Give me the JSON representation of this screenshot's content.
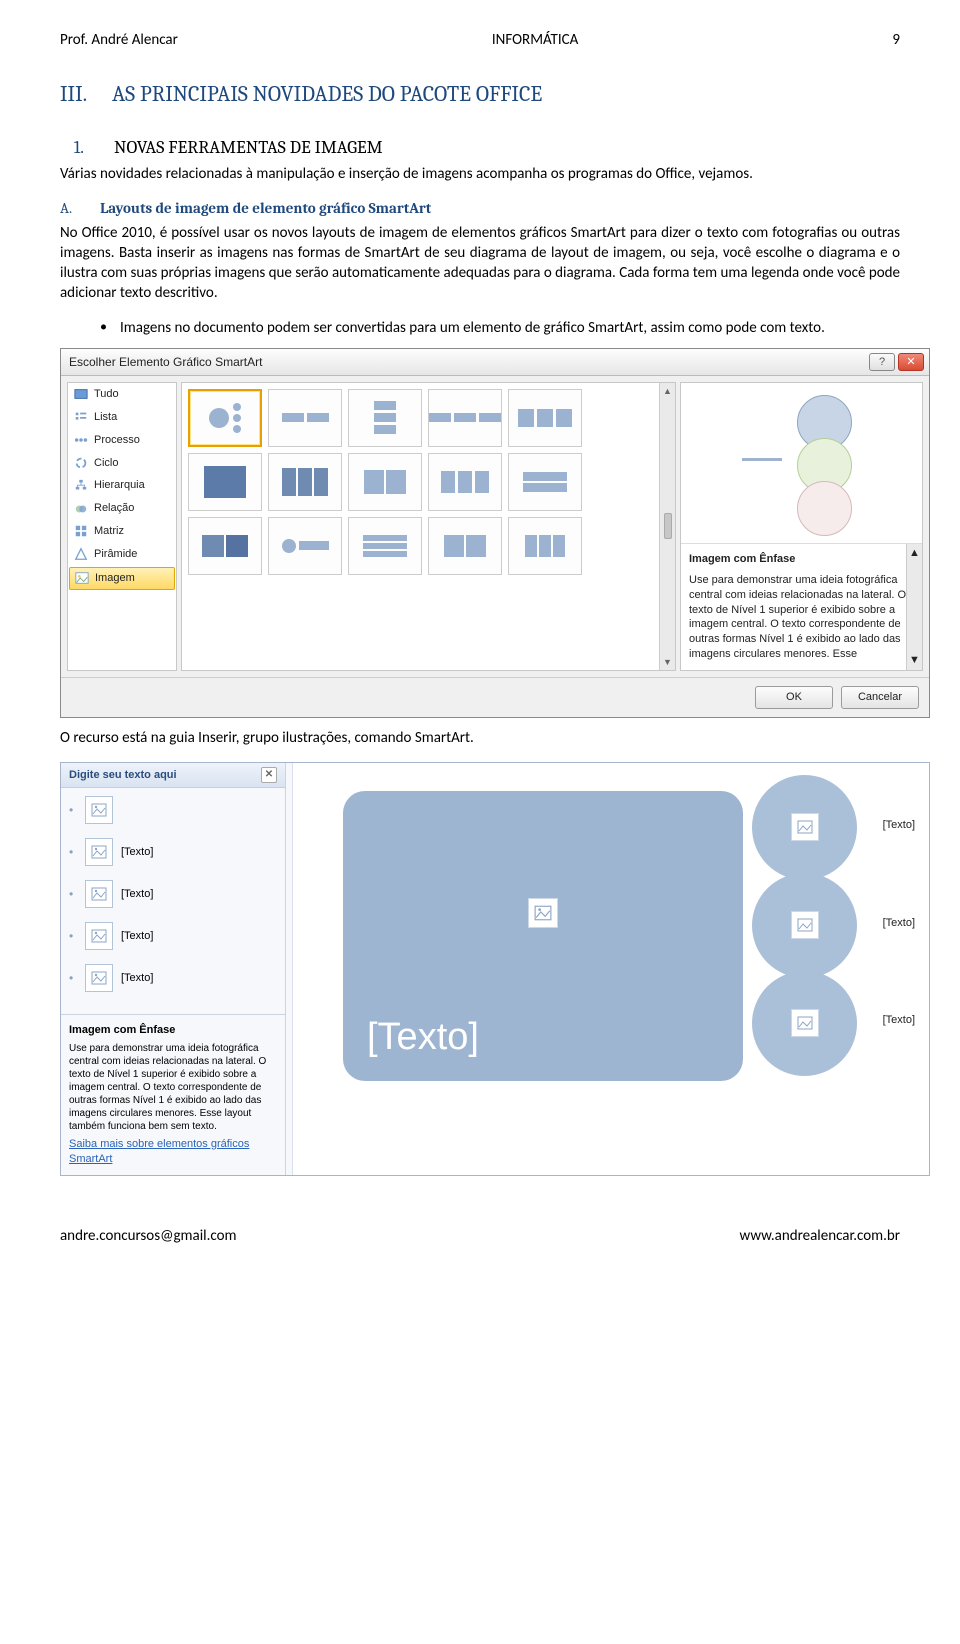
{
  "header": {
    "author": "Prof. André Alencar",
    "subject": "INFORMÁTICA",
    "page": "9"
  },
  "section": {
    "num": "III.",
    "title": "AS PRINCIPAIS NOVIDADES DO PACOTE OFFICE"
  },
  "sub1": {
    "num": "1.",
    "title": "NOVAS FERRAMENTAS DE IMAGEM"
  },
  "para1": "Várias novidades relacionadas à manipulação e inserção de imagens acompanha os programas do Office, vejamos.",
  "letterA": {
    "num": "A.",
    "title": "Layouts de imagem de elemento gráfico SmartArt"
  },
  "para2": "No Office 2010, é possível usar os novos layouts de imagem de elementos gráficos SmartArt para dizer o texto com fotografias ou outras imagens. Basta inserir as imagens nas formas de SmartArt de seu diagrama de layout de imagem, ou seja, você escolhe o diagrama e o ilustra com suas próprias imagens que serão automaticamente adequadas para o diagrama. Cada forma tem uma legenda onde você pode adicionar texto descritivo.",
  "bullet1": "Imagens no documento podem ser convertidas para um elemento de gráfico SmartArt, assim como pode com texto.",
  "dialog": {
    "title": "Escolher Elemento Gráfico SmartArt",
    "categories": [
      "Tudo",
      "Lista",
      "Processo",
      "Ciclo",
      "Hierarquia",
      "Relação",
      "Matriz",
      "Pirâmide",
      "Imagem"
    ],
    "selected_category": "Imagem",
    "preview_title": "Imagem com Ênfase",
    "preview_text": "Use para demonstrar uma ideia fotográfica central com ideias relacionadas na lateral. O texto de Nível 1 superior é exibido sobre a imagem central. O texto correspondente de outras formas Nível 1 é exibido ao lado das imagens circulares menores. Esse",
    "ok": "OK",
    "cancel": "Cancelar"
  },
  "after_dialog": "O recurso está na guia Inserir, grupo ilustrações, comando SmartArt.",
  "panel": {
    "head": "Digite seu texto aqui",
    "item_label": "[Texto]",
    "foot_title": "Imagem com Ênfase",
    "foot_body": "Use para demonstrar uma ideia fotográfica central com ideias relacionadas na lateral. O texto de Nível 1 superior é exibido sobre a imagem central. O texto correspondente de outras formas Nível 1 é exibido ao lado das imagens circulares menores. Esse layout também funciona bem sem texto.",
    "foot_link1": "Saiba mais sobre elementos gráficos",
    "foot_link2": "SmartArt",
    "big_caption": "[Texto]",
    "side_label": "[Texto]"
  },
  "footer": {
    "email": "andre.concursos@gmail.com",
    "site": "www.andrealencar.com.br"
  }
}
